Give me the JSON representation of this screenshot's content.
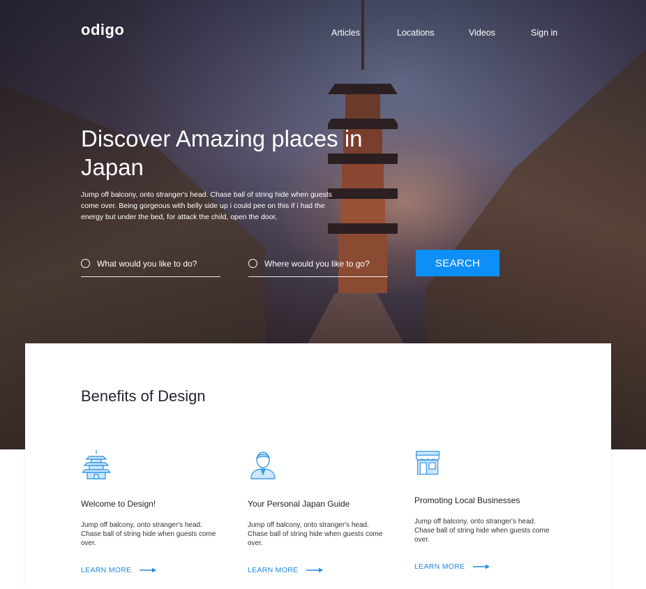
{
  "brand": {
    "logo": "odigo"
  },
  "nav": {
    "items": [
      "Articles",
      "Locations",
      "Videos",
      "Sign in"
    ]
  },
  "hero": {
    "headline": "Discover Amazing places in Japan",
    "lead": "Jump off balcony, onto stranger's head. Chase ball of string hide when guests come over. Being gorgeous with belly side up i could pee on this if i had the energy but under the bed, for attack the child, open the door,"
  },
  "search": {
    "activity_placeholder": "What would you like to do?",
    "location_placeholder": "Where would you like to go?",
    "button_label": "SEARCH"
  },
  "benefits": {
    "heading": "Benefits of Design",
    "items": [
      {
        "icon": "pagoda-icon",
        "title": "Welcome to Design!",
        "text": "Jump off balcony, onto stranger's head. Chase ball of string hide when guests come over.",
        "link": "LEARN MORE"
      },
      {
        "icon": "guide-person-icon",
        "title": "Your Personal Japan Guide",
        "text": "Jump off balcony, onto stranger's head. Chase ball of string hide when guests come over.",
        "link": "LEARN MORE"
      },
      {
        "icon": "storefront-icon",
        "title": "Promoting Local Businesses",
        "text": "Jump off balcony, onto stranger's head. Chase ball of string hide when guests come over.",
        "link": "LEARN MORE"
      }
    ]
  },
  "colors": {
    "accent": "#0d8ff7",
    "link": "#1e88e5",
    "icon": "#3a9be8",
    "icon_fill": "#cfe6fb"
  }
}
